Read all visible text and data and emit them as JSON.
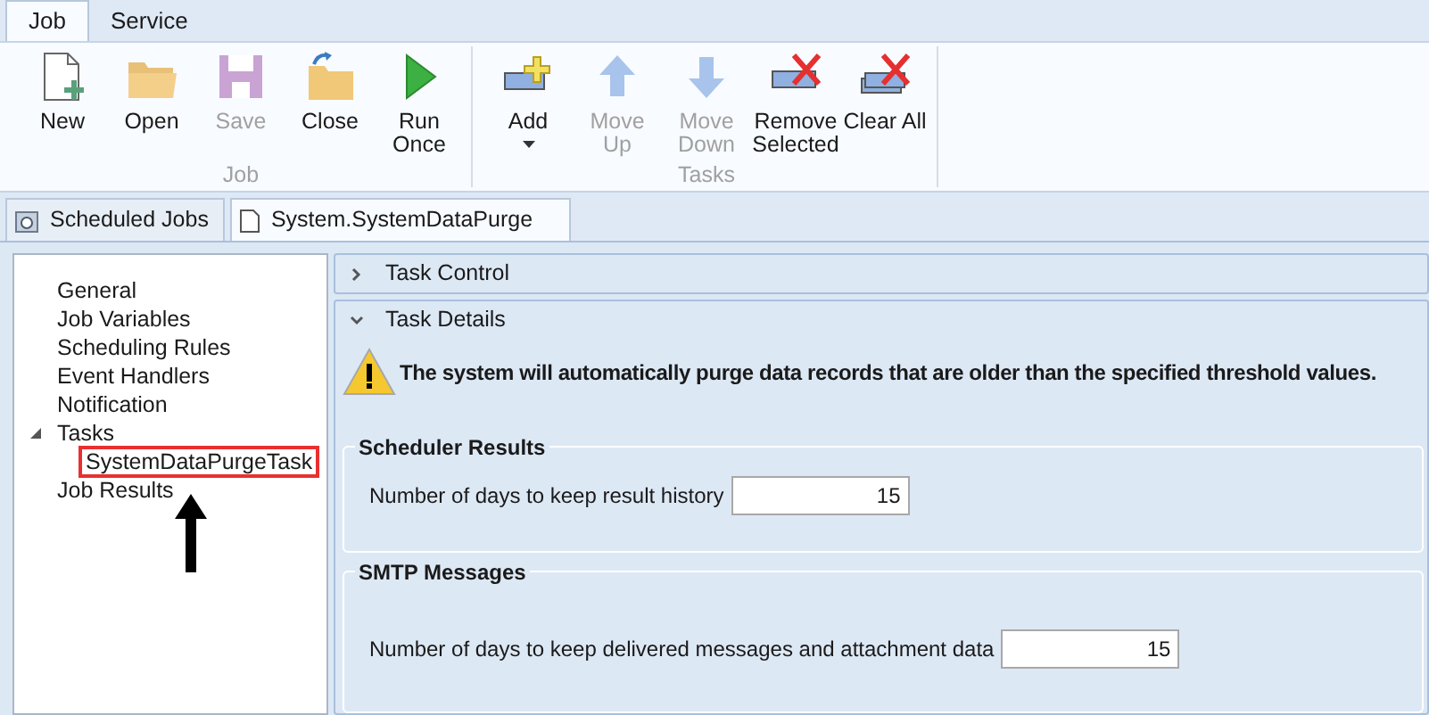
{
  "ribbon_tabs": [
    {
      "label": "Job",
      "selected": true
    },
    {
      "label": "Service",
      "selected": false
    }
  ],
  "ribbon_groups": [
    {
      "title": "Job",
      "buttons": [
        {
          "kind": "new",
          "label": "New",
          "disabled": false
        },
        {
          "kind": "open",
          "label": "Open",
          "disabled": false
        },
        {
          "kind": "save",
          "label": "Save",
          "disabled": true
        },
        {
          "kind": "close",
          "label": "Close",
          "disabled": false
        },
        {
          "kind": "run",
          "label": "Run Once",
          "disabled": false
        }
      ]
    },
    {
      "title": "Tasks",
      "buttons": [
        {
          "kind": "add",
          "label": "Add",
          "disabled": false,
          "dropdown": true
        },
        {
          "kind": "up",
          "label": "Move Up",
          "disabled": true
        },
        {
          "kind": "down",
          "label": "Move Down",
          "disabled": true
        },
        {
          "kind": "remove",
          "label": "Remove Selected",
          "disabled": false
        },
        {
          "kind": "clear",
          "label": "Clear All",
          "disabled": false
        }
      ]
    }
  ],
  "document_tabs": [
    {
      "kind": "jobs",
      "label": "Scheduled Jobs",
      "selected": false
    },
    {
      "kind": "doc",
      "label": "System.SystemDataPurge",
      "selected": true
    }
  ],
  "tree": [
    {
      "label": "General"
    },
    {
      "label": "Job Variables"
    },
    {
      "label": "Scheduling Rules"
    },
    {
      "label": "Event Handlers"
    },
    {
      "label": "Notification"
    },
    {
      "label": "Tasks",
      "expanded": true,
      "children": [
        {
          "label": "SystemDataPurgeTask",
          "highlighted": true
        }
      ]
    },
    {
      "label": "Job Results"
    }
  ],
  "sections": [
    {
      "title": "Task Control",
      "expanded": false
    },
    {
      "title": "Task Details",
      "expanded": true,
      "warning": "The system will automatically purge data records that are older than the specified threshold values.",
      "groups": [
        {
          "title": "Scheduler Results",
          "field_label": "Number of days to keep result history",
          "value": "15"
        },
        {
          "title": "SMTP Messages",
          "field_label": "Number of days to keep delivered messages and attachment data",
          "value": "15"
        }
      ]
    }
  ]
}
